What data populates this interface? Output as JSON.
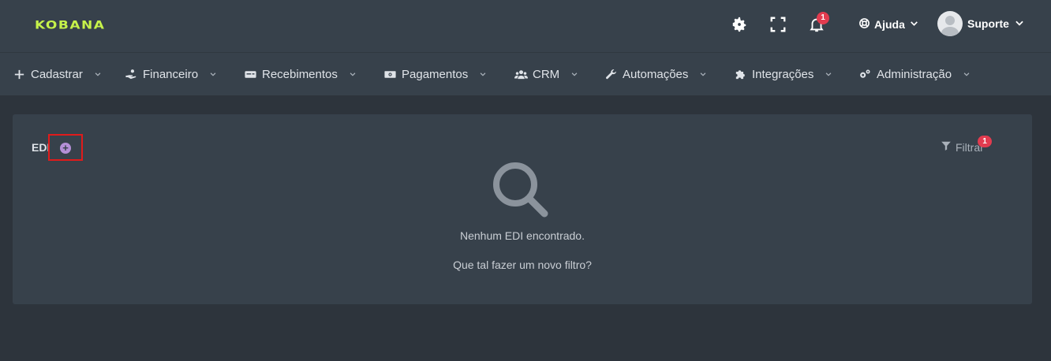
{
  "header": {
    "logo": "KOBANA",
    "icons": [
      "gear-icon",
      "fullscreen-icon",
      "bell-icon"
    ],
    "notifications_count": "1",
    "help_label": "Ajuda",
    "user_name": "Suporte"
  },
  "nav": {
    "items": [
      {
        "label": "Cadastrar",
        "icon": "plus-icon"
      },
      {
        "label": "Financeiro",
        "icon": "hand-money-icon"
      },
      {
        "label": "Recebimentos",
        "icon": "card-icon"
      },
      {
        "label": "Pagamentos",
        "icon": "money-icon"
      },
      {
        "label": "CRM",
        "icon": "users-icon"
      },
      {
        "label": "Automações",
        "icon": "wrench-icon"
      },
      {
        "label": "Integrações",
        "icon": "puzzle-icon"
      },
      {
        "label": "Administração",
        "icon": "cogs-icon"
      }
    ]
  },
  "main": {
    "title": "EDI",
    "add_symbol": "+",
    "filter_label": "Filtrar",
    "filter_count": "1",
    "empty_title": "Nenhum EDI encontrado.",
    "empty_hint": "Que tal fazer um novo filtro?"
  },
  "colors": {
    "background": "#2d343c",
    "panel": "#37414b",
    "logo": "#c6f24a",
    "badge": "#e23b4f",
    "highlight_border": "#e01b1b",
    "add_button": "#b48fd6"
  }
}
